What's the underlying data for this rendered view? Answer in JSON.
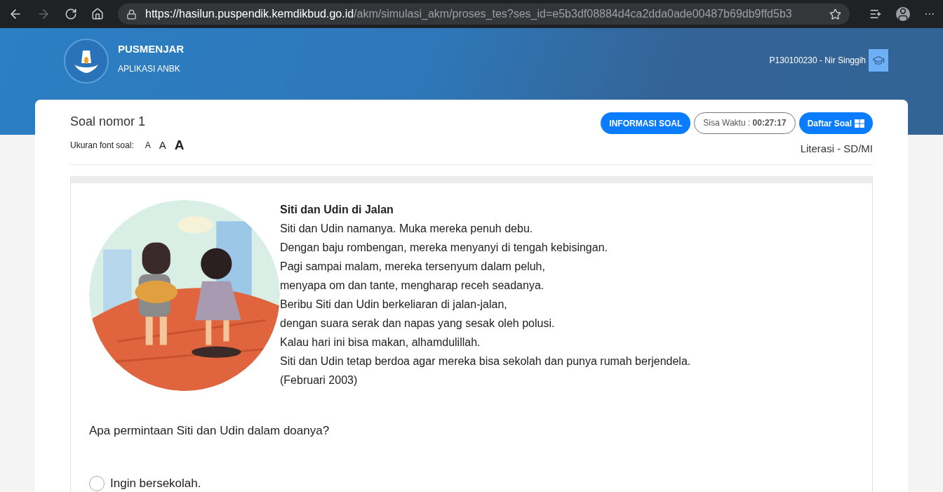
{
  "browser": {
    "url_host": "https://hasilun.puspendik.kemdikbud.go.id",
    "url_path": "/akm/simulasi_akm/proses_tes?ses_id=e5b3df08884d4ca2dda0ade00487b69db9ffd5b3",
    "more": "···"
  },
  "header": {
    "brand": "PUSMENJAR",
    "subtitle": "APLIKASI ANBK",
    "user": "P130100230 - Nir Singgih"
  },
  "question": {
    "title": "Soal nomor 1",
    "font_label": "Ukuran font soal:",
    "font_sizes": [
      {
        "label": "A",
        "kind": "small"
      },
      {
        "label": "A",
        "kind": "medium"
      },
      {
        "label": "A",
        "kind": "large"
      }
    ],
    "info_button": "INFORMASI SOAL",
    "timer": "Sisa Waktu : **00:27:17**",
    "list_button": "Daftar Soal",
    "subject": "Literasi - SD/MI"
  },
  "passage": {
    "title": "Siti dan Udin di Jalan",
    "lines": [
      "Siti dan Udin namanya. Muka mereka penuh debu.",
      "Dengan baju rombengan, mereka menyanyi di tengah kebisingan.",
      "Pagi sampai malam, mereka tersenyum dalam peluh,",
      "menyapa om dan tante, mengharap receh seadanya.",
      "Beribu Siti dan Udin berkeliaran di jalan-jalan,",
      "dengan suara serak dan napas yang sesak oleh polusi.",
      "Kalau hari ini bisa makan, alhamdulillah.",
      "Siti dan Udin tetap berdoa agar mereka bisa sekolah dan punya rumah berjendela.",
      "(Februari 2003)"
    ]
  },
  "prompt": "Apa permintaan Siti dan Udin dalam doanya?",
  "options": [
    {
      "label": "Ingin bersekolah.",
      "selected": false
    }
  ]
}
